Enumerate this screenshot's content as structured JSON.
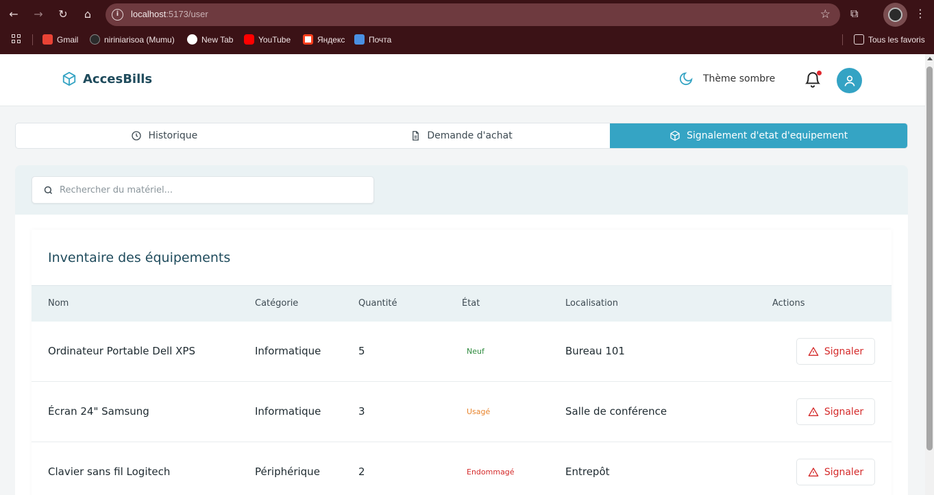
{
  "browser": {
    "url_host": "localhost",
    "url_path": ":5173/user",
    "bookmarks": [
      {
        "label": "Gmail",
        "color": "#ea4335"
      },
      {
        "label": "niriniarisoa (Mumu)",
        "color": "#2b2b2b"
      },
      {
        "label": "New Tab",
        "color": "#ffffff"
      },
      {
        "label": "YouTube",
        "color": "#ff0000"
      },
      {
        "label": "Яндекс",
        "color": "#fc3f1d"
      },
      {
        "label": "Почта",
        "color": "#4a90e2"
      }
    ],
    "all_bookmarks": "Tous les favoris"
  },
  "header": {
    "brand": "AccesBills",
    "theme_label": "Thème sombre"
  },
  "tabs": [
    {
      "label": "Historique",
      "icon": "clock-icon",
      "active": false
    },
    {
      "label": "Demande d'achat",
      "icon": "document-icon",
      "active": false
    },
    {
      "label": "Signalement d'etat d'equipement",
      "icon": "package-icon",
      "active": true
    }
  ],
  "search": {
    "placeholder": "Rechercher du matériel..."
  },
  "inventory": {
    "title": "Inventaire des équipements",
    "columns": [
      "Nom",
      "Catégorie",
      "Quantité",
      "État",
      "Localisation",
      "Actions"
    ],
    "rows": [
      {
        "nom": "Ordinateur Portable Dell XPS",
        "categorie": "Informatique",
        "quantite": "5",
        "etat": "Neuf",
        "etat_color": "#2e8b3e",
        "localisation": "Bureau 101",
        "action": "Signaler"
      },
      {
        "nom": "Écran 24\" Samsung",
        "categorie": "Informatique",
        "quantite": "3",
        "etat": "Usagé",
        "etat_color": "#e8832a",
        "localisation": "Salle de conférence",
        "action": "Signaler"
      },
      {
        "nom": "Clavier sans fil Logitech",
        "categorie": "Périphérique",
        "quantite": "2",
        "etat": "Endommagé",
        "etat_color": "#d42a2a",
        "localisation": "Entrepôt",
        "action": "Signaler"
      }
    ]
  },
  "colors": {
    "accent": "#35a4c4",
    "brand_text": "#1f4b5c",
    "danger": "#d42a2a"
  }
}
